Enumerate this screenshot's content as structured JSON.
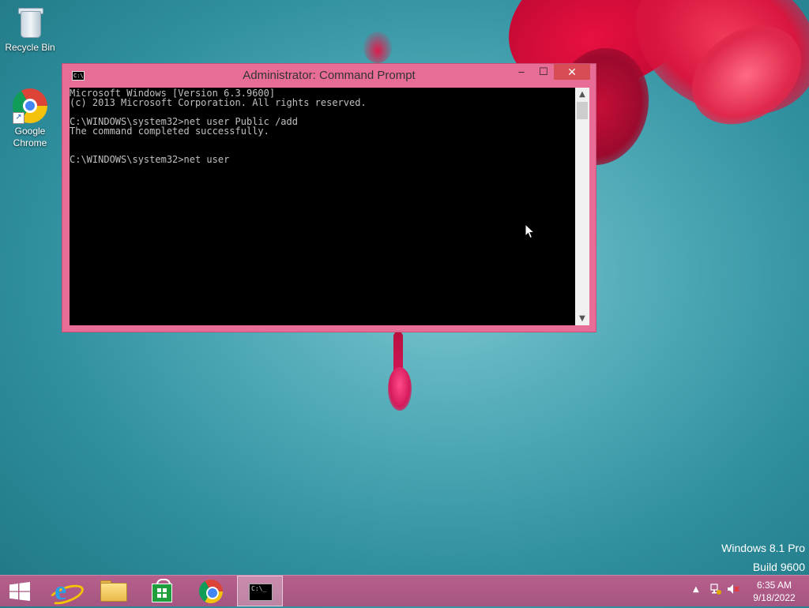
{
  "desktop": {
    "icons": [
      {
        "label": "Recycle Bin",
        "icon": "recycle-bin-icon"
      },
      {
        "label": "Google\nChrome",
        "line1": "Google",
        "line2": "Chrome",
        "icon": "chrome-icon"
      }
    ],
    "watermark": {
      "line1": "Windows 8.1 Pro",
      "line2": "Build 9600"
    }
  },
  "cmd_window": {
    "title": "Administrator: Command Prompt",
    "buttons": {
      "minimize": "–",
      "maximize": "☐",
      "close": "✕"
    },
    "console_text": "Microsoft Windows [Version 6.3.9600]\n(c) 2013 Microsoft Corporation. All rights reserved.\n\nC:\\WINDOWS\\system32>net user Public /add\nThe command completed successfully.\n\n\nC:\\WINDOWS\\system32>net user",
    "scroll_up": "▲",
    "scroll_down": "▼"
  },
  "taskbar": {
    "items": [
      {
        "name": "start",
        "icon": "windows-logo-icon"
      },
      {
        "name": "internet-explorer",
        "icon": "internet-explorer-icon"
      },
      {
        "name": "file-explorer",
        "icon": "folder-icon"
      },
      {
        "name": "store",
        "icon": "store-icon"
      },
      {
        "name": "chrome",
        "icon": "chrome-icon"
      },
      {
        "name": "command-prompt",
        "icon": "command-prompt-icon",
        "active": true
      }
    ],
    "tray": {
      "arrow": "▲",
      "time": "6:35 AM",
      "date": "9/18/2022"
    }
  },
  "colors": {
    "window_frame": "#e86d96",
    "close_button": "#d84c55",
    "taskbar": "#a45581",
    "console_bg": "#000000",
    "console_fg": "#c0c0c0"
  }
}
